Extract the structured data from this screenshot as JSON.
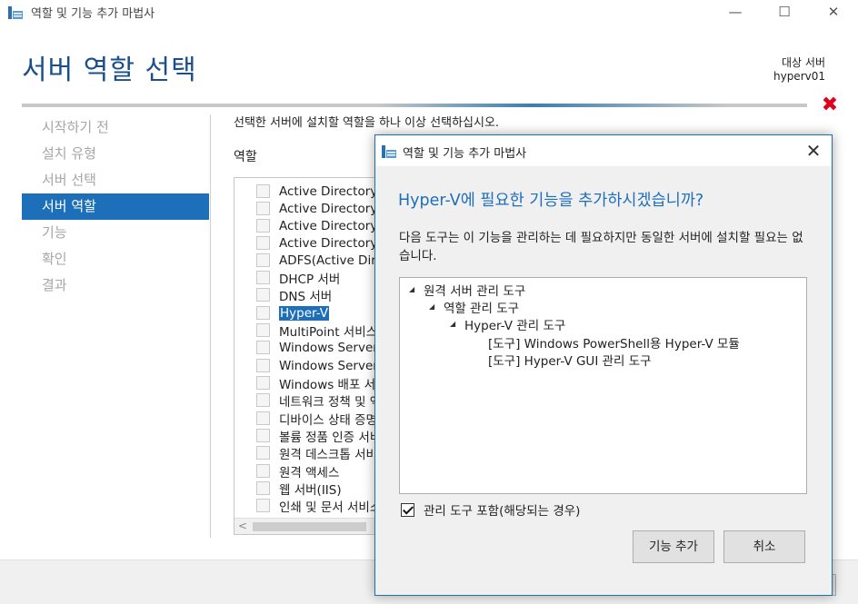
{
  "window": {
    "title": "역할 및 기능 추가 마법사",
    "minimize_glyph": "—",
    "maximize_glyph": "☐",
    "close_glyph": "✕"
  },
  "page": {
    "title": "서버 역할 선택",
    "destination_label": "대상 서버",
    "destination_server": "hyperv01",
    "error_glyph": "✖",
    "instruction": "선택한 서버에 설치할 역할을 하나 이상 선택하십시오.",
    "roles_header": "역할"
  },
  "nav": [
    {
      "label": "시작하기 전",
      "active": false
    },
    {
      "label": "설치 유형",
      "active": false
    },
    {
      "label": "서버 선택",
      "active": false
    },
    {
      "label": "서버 역할",
      "active": true
    },
    {
      "label": "기능",
      "active": false
    },
    {
      "label": "확인",
      "active": false
    },
    {
      "label": "결과",
      "active": false
    }
  ],
  "roles": [
    "Active Directory Certificate Services",
    "Active Directory Domain Services",
    "Active Directory Federation Services",
    "Active Directory Lightweight Directory Services",
    "ADFS(Active Directory Rights Management Services)",
    "DHCP 서버",
    "DNS 서버",
    "Hyper-V",
    "MultiPoint 서비스",
    "Windows Server Essentials Experience",
    "Windows Server Update Services",
    "Windows 배포 서비스",
    "네트워크 정책 및 액세스 서비스",
    "디바이스 상태 증명",
    "볼륨 정품 인증 서비스",
    "원격 데스크톱 서비스",
    "원격 액세스",
    "웹 서버(IIS)",
    "인쇄 및 문서 서비스"
  ],
  "selected_role": "Hyper-V",
  "scroll_left_glyph": "<",
  "dialog": {
    "title": "역할 및 기능 추가 마법사",
    "close_glyph": "✕",
    "header": "Hyper-V에 필요한 기능을 추가하시겠습니까?",
    "description": "다음 도구는 이 기능을 관리하는 데 필요하지만 동일한 서버에 설치할 필요는 없습니다.",
    "tree": [
      {
        "label": "원격 서버 관리 도구",
        "level": 0,
        "expanded": true
      },
      {
        "label": "역할 관리 도구",
        "level": 1,
        "expanded": true
      },
      {
        "label": "Hyper-V 관리 도구",
        "level": 2,
        "expanded": true
      },
      {
        "label": "[도구] Windows PowerShell용 Hyper-V 모듈",
        "level": 3,
        "expanded": false
      },
      {
        "label": "[도구] Hyper-V GUI 관리 도구",
        "level": 3,
        "expanded": false
      }
    ],
    "include_tools_label": "관리 도구 포함(해당되는 경우)",
    "include_tools_checked": true,
    "add_features_button": "기능 추가",
    "cancel_button": "취소"
  }
}
